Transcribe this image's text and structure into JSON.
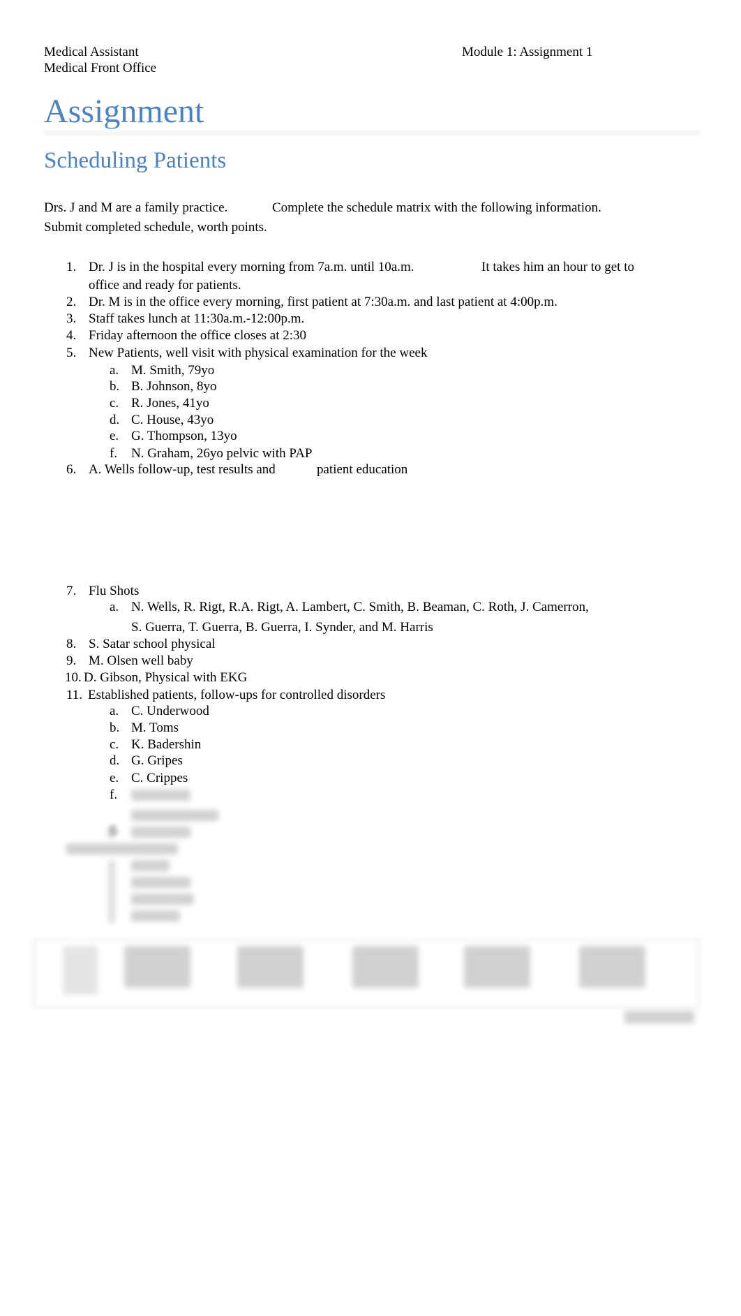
{
  "header": {
    "left_line1": "Medical Assistant",
    "left_line2": "Medical Front Office",
    "right": "Module 1: Assignment 1"
  },
  "title": "Assignment",
  "subtitle": "Scheduling Patients",
  "intro": {
    "part1": "Drs. J and M are a family practice.",
    "part2": "Complete the schedule matrix with the following information.",
    "line2": "Submit completed schedule, worth points."
  },
  "items": {
    "i1": {
      "num": "1.",
      "text": "Dr. J is in the hospital every morning from 7a.m. until 10a.m.",
      "text2": "It takes him an hour to get to",
      "cont": "office and ready for patients."
    },
    "i2": {
      "num": "2.",
      "text": "Dr. M is in the office every morning, first patient at 7:30a.m. and last patient at 4:00p.m."
    },
    "i3": {
      "num": "3.",
      "text": "Staff takes lunch at 11:30a.m.-12:00p.m."
    },
    "i4": {
      "num": "4.",
      "text": "Friday afternoon the office closes at 2:30"
    },
    "i5": {
      "num": "5.",
      "text": "New Patients, well visit with physical examination for the week",
      "sub": [
        {
          "l": "a.",
          "t": "M. Smith, 79yo"
        },
        {
          "l": "b.",
          "t": "B. Johnson, 8yo"
        },
        {
          "l": "c.",
          "t": "R. Jones, 41yo"
        },
        {
          "l": "d.",
          "t": "C. House, 43yo"
        },
        {
          "l": "e.",
          "t": "G. Thompson, 13yo"
        },
        {
          "l": "f.",
          "t": "N. Graham, 26yo pelvic with PAP"
        }
      ]
    },
    "i6": {
      "num": "6.",
      "text": "A. Wells follow-up, test results and",
      "text2": "patient education"
    },
    "i7": {
      "num": "7.",
      "text": "Flu Shots",
      "sub_l": "a.",
      "sub_t": "N. Wells, R. Rigt, R.A. Rigt, A. Lambert, C. Smith, B. Beaman, C. Roth, J. Camerron,",
      "sub_cont": "S. Guerra, T. Guerra, B. Guerra, I. Synder, and M. Harris"
    },
    "i8": {
      "num": "8.",
      "text": "S. Satar school physical"
    },
    "i9": {
      "num": "9.",
      "text": "M. Olsen well baby"
    },
    "i10": {
      "num": "10.",
      "text": "D. Gibson, Physical with EKG"
    },
    "i11": {
      "num": "11.",
      "text": "Established patients, follow-ups for controlled disorders",
      "sub": [
        {
          "l": "a.",
          "t": "C. Underwood"
        },
        {
          "l": "b.",
          "t": "M. Toms"
        },
        {
          "l": "c.",
          "t": "K. Badershin"
        },
        {
          "l": "d.",
          "t": "G. Gripes"
        },
        {
          "l": "e.",
          "t": "C. Crippes"
        },
        {
          "l": "f.",
          "t": ""
        }
      ]
    }
  }
}
